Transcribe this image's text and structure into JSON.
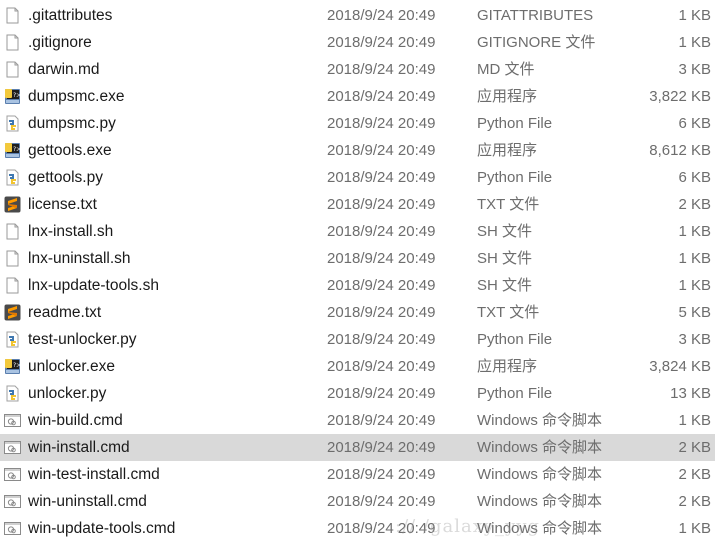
{
  "files": [
    {
      "name": ".gitattributes",
      "date": "2018/9/24 20:49",
      "type": "GITATTRIBUTES",
      "size": "1 KB",
      "icon": "blank-file-icon"
    },
    {
      "name": ".gitignore",
      "date": "2018/9/24 20:49",
      "type": "GITIGNORE 文件",
      "size": "1 KB",
      "icon": "blank-file-icon"
    },
    {
      "name": "darwin.md",
      "date": "2018/9/24 20:49",
      "type": "MD 文件",
      "size": "3 KB",
      "icon": "blank-file-icon"
    },
    {
      "name": "dumpsmc.exe",
      "date": "2018/9/24 20:49",
      "type": "应用程序",
      "size": "3,822 KB",
      "icon": "python-exe-icon"
    },
    {
      "name": "dumpsmc.py",
      "date": "2018/9/24 20:49",
      "type": "Python File",
      "size": "6 KB",
      "icon": "python-file-icon"
    },
    {
      "name": "gettools.exe",
      "date": "2018/9/24 20:49",
      "type": "应用程序",
      "size": "8,612 KB",
      "icon": "python-exe-icon"
    },
    {
      "name": "gettools.py",
      "date": "2018/9/24 20:49",
      "type": "Python File",
      "size": "6 KB",
      "icon": "python-file-icon"
    },
    {
      "name": "license.txt",
      "date": "2018/9/24 20:49",
      "type": "TXT 文件",
      "size": "2 KB",
      "icon": "sublime-text-icon"
    },
    {
      "name": "lnx-install.sh",
      "date": "2018/9/24 20:49",
      "type": "SH 文件",
      "size": "1 KB",
      "icon": "blank-file-icon"
    },
    {
      "name": "lnx-uninstall.sh",
      "date": "2018/9/24 20:49",
      "type": "SH 文件",
      "size": "1 KB",
      "icon": "blank-file-icon"
    },
    {
      "name": "lnx-update-tools.sh",
      "date": "2018/9/24 20:49",
      "type": "SH 文件",
      "size": "1 KB",
      "icon": "blank-file-icon"
    },
    {
      "name": "readme.txt",
      "date": "2018/9/24 20:49",
      "type": "TXT 文件",
      "size": "5 KB",
      "icon": "sublime-text-icon"
    },
    {
      "name": "test-unlocker.py",
      "date": "2018/9/24 20:49",
      "type": "Python File",
      "size": "3 KB",
      "icon": "python-file-icon"
    },
    {
      "name": "unlocker.exe",
      "date": "2018/9/24 20:49",
      "type": "应用程序",
      "size": "3,824 KB",
      "icon": "python-exe-icon"
    },
    {
      "name": "unlocker.py",
      "date": "2018/9/24 20:49",
      "type": "Python File",
      "size": "13 KB",
      "icon": "python-file-icon"
    },
    {
      "name": "win-build.cmd",
      "date": "2018/9/24 20:49",
      "type": "Windows 命令脚本",
      "size": "1 KB",
      "icon": "cmd-script-icon"
    },
    {
      "name": "win-install.cmd",
      "date": "2018/9/24 20:49",
      "type": "Windows 命令脚本",
      "size": "2 KB",
      "icon": "cmd-script-icon",
      "selected": true
    },
    {
      "name": "win-test-install.cmd",
      "date": "2018/9/24 20:49",
      "type": "Windows 命令脚本",
      "size": "2 KB",
      "icon": "cmd-script-icon"
    },
    {
      "name": "win-uninstall.cmd",
      "date": "2018/9/24 20:49",
      "type": "Windows 命令脚本",
      "size": "2 KB",
      "icon": "cmd-script-icon"
    },
    {
      "name": "win-update-tools.cmd",
      "date": "2018/9/24 20:49",
      "type": "Windows 命令脚本",
      "size": "1 KB",
      "icon": "cmd-script-icon"
    }
  ],
  "watermark": "://          /galaxy_yyg",
  "colors": {
    "selected_row": "#d9d9d9",
    "name_text": "#1a1a1a",
    "meta_text": "#6d6d6d"
  }
}
